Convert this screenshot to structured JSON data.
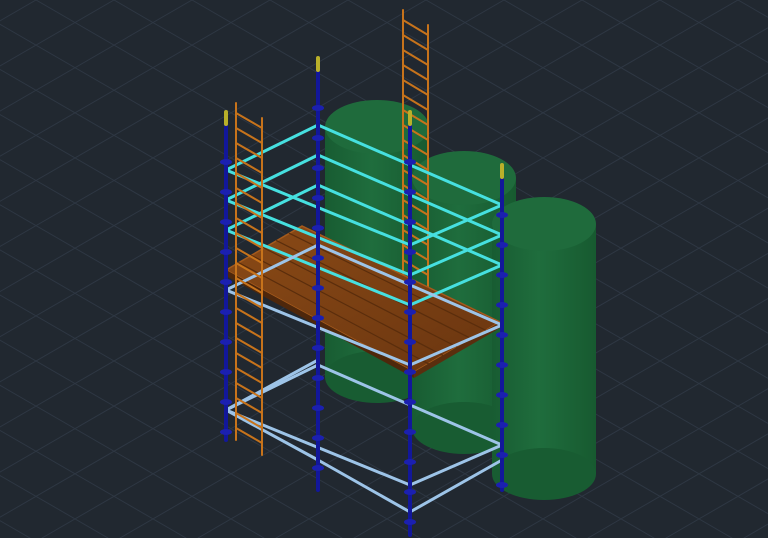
{
  "viewport": {
    "background": "#212830",
    "grid_color": "#2e3743",
    "visual_style": "shaded",
    "view": "isometric"
  },
  "scene_objects": [
    {
      "name": "storage-tank-back",
      "type": "cylinder",
      "color": "#1e6a3b"
    },
    {
      "name": "storage-tank-middle",
      "type": "cylinder",
      "color": "#1e6a3b"
    },
    {
      "name": "storage-tank-front",
      "type": "cylinder",
      "color": "#1e6a3b"
    },
    {
      "name": "scaffold-tower",
      "type": "ringlock-scaffold",
      "standard_color": "#12179a",
      "cap_color": "#b9b02a",
      "ledger_color": "#46e0e0",
      "lower_ledger_color": "#9dc4e8"
    },
    {
      "name": "work-platform",
      "type": "plank-deck",
      "color": "#7a3e12"
    },
    {
      "name": "access-ladder-left",
      "type": "ladder",
      "color": "#c7731b"
    },
    {
      "name": "access-ladder-rear",
      "type": "ladder",
      "color": "#c7731b"
    }
  ]
}
